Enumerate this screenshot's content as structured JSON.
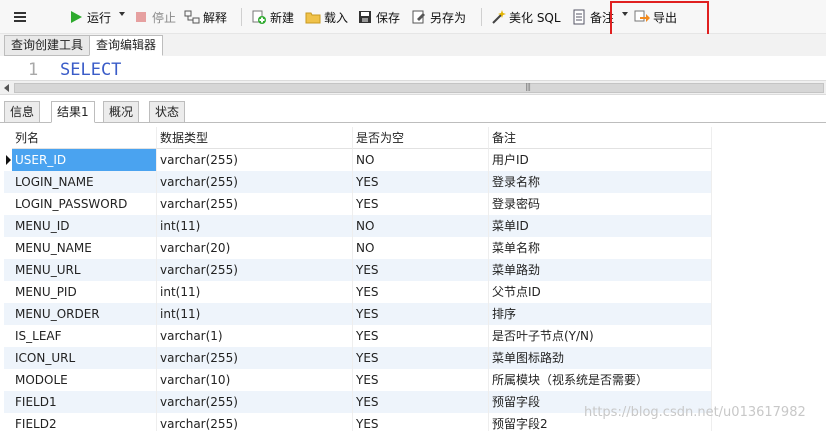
{
  "toolbar": {
    "run_label": "运行",
    "stop_label": "停止",
    "explain_label": "解释",
    "new_label": "新建",
    "load_label": "载入",
    "save_label": "保存",
    "save_as_label": "另存为",
    "beautify_label": "美化 SQL",
    "comment_label": "备注",
    "export_label": "导出"
  },
  "query_tabs": [
    "查询创建工具",
    "查询编辑器"
  ],
  "editor": {
    "line_number": "1",
    "code": "SELECT"
  },
  "result_tabs": [
    "信息",
    "结果1",
    "概况",
    "状态"
  ],
  "grid": {
    "columns": [
      "列名",
      "数据类型",
      "是否为空",
      "备注"
    ],
    "rows": [
      [
        "USER_ID",
        "varchar(255)",
        "NO",
        "用户ID"
      ],
      [
        "LOGIN_NAME",
        "varchar(255)",
        "YES",
        "登录名称"
      ],
      [
        "LOGIN_PASSWORD",
        "varchar(255)",
        "YES",
        "登录密码"
      ],
      [
        "MENU_ID",
        "int(11)",
        "NO",
        "菜单ID"
      ],
      [
        "MENU_NAME",
        "varchar(20)",
        "NO",
        "菜单名称"
      ],
      [
        "MENU_URL",
        "varchar(255)",
        "YES",
        "菜单路劲"
      ],
      [
        "MENU_PID",
        "int(11)",
        "YES",
        "父节点ID"
      ],
      [
        "MENU_ORDER",
        "int(11)",
        "YES",
        "排序"
      ],
      [
        "IS_LEAF",
        "varchar(1)",
        "YES",
        "是否叶子节点(Y/N)"
      ],
      [
        "ICON_URL",
        "varchar(255)",
        "YES",
        "菜单图标路劲"
      ],
      [
        "MODOLE",
        "varchar(10)",
        "YES",
        "所属模块（视系统是否需要）"
      ],
      [
        "FIELD1",
        "varchar(255)",
        "YES",
        "预留字段"
      ],
      [
        "FIELD2",
        "varchar(255)",
        "YES",
        "预留字段2"
      ]
    ]
  },
  "watermark": "https://blog.csdn.net/u013617982",
  "colors": {
    "selected_cell": "#4aa3f0",
    "run_icon": "#2eaa2e",
    "highlight_box": "#e02020",
    "row_alt": "#eef4fb"
  }
}
